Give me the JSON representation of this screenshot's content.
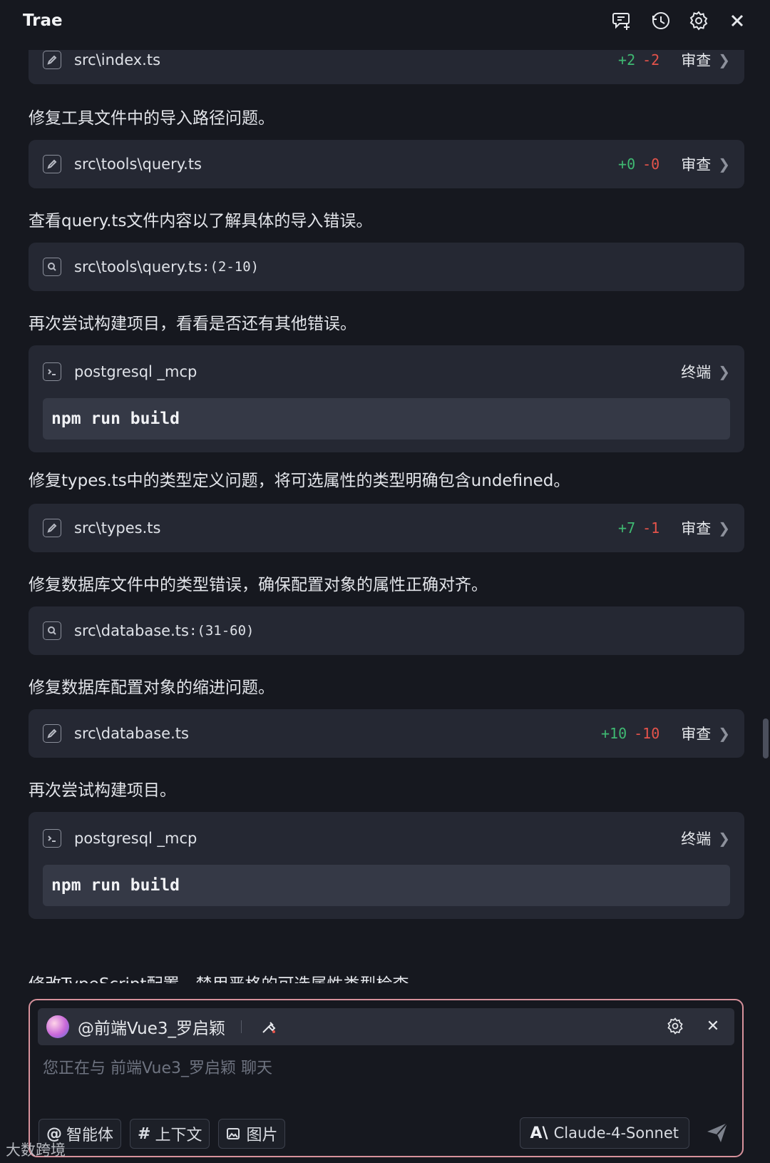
{
  "app_title": "Trae",
  "top_icons": [
    "new-chat-icon",
    "history-icon",
    "settings-icon",
    "close-icon"
  ],
  "feed": {
    "cards": [
      {
        "kind": "edit",
        "path": "src\\index.ts",
        "add": "+2",
        "del": "-2",
        "action": "审查"
      },
      {
        "kind": "text",
        "text": "修复工具文件中的导入路径问题。"
      },
      {
        "kind": "edit",
        "path": "src\\tools\\query.ts",
        "add": "+0",
        "del": "-0",
        "action": "审查"
      },
      {
        "kind": "text",
        "text": "查看query.ts文件内容以了解具体的导入错误。"
      },
      {
        "kind": "view",
        "path": "src\\tools\\query.ts",
        "range": ":(2-10)"
      },
      {
        "kind": "text",
        "text": "再次尝试构建项目，看看是否还有其他错误。"
      },
      {
        "kind": "terminal",
        "name": "postgresql _mcp",
        "action": "终端",
        "command": "npm run build"
      },
      {
        "kind": "text",
        "text": "修复types.ts中的类型定义问题，将可选属性的类型明确包含undefined。"
      },
      {
        "kind": "edit",
        "path": "src\\types.ts",
        "add": "+7",
        "del": "-1",
        "action": "审查"
      },
      {
        "kind": "text",
        "text": "修复数据库文件中的类型错误，确保配置对象的属性正确对齐。"
      },
      {
        "kind": "view",
        "path": "src\\database.ts",
        "range": ":(31-60)"
      },
      {
        "kind": "text",
        "text": "修复数据库配置对象的缩进问题。"
      },
      {
        "kind": "edit",
        "path": "src\\database.ts",
        "add": "+10",
        "del": "-10",
        "action": "审查"
      },
      {
        "kind": "text",
        "text": "再次尝试构建项目。"
      },
      {
        "kind": "terminal",
        "name": "postgresql _mcp",
        "action": "终端",
        "command": "npm run build"
      },
      {
        "kind": "text",
        "text": "修改TypeScript配置，禁用严格的可选属性类型检查"
      }
    ]
  },
  "composer": {
    "agent": "@前端Vue3_罗启颖",
    "placeholder": "您正在与 前端Vue3_罗启颖 聊天",
    "chips": [
      {
        "symbol": "@",
        "label": "智能体"
      },
      {
        "symbol": "#",
        "label": "上下文"
      },
      {
        "symbol": "",
        "label": "图片"
      }
    ],
    "model": "Claude-4-Sonnet",
    "model_logo": "A\\"
  },
  "watermark": "大数跨境"
}
